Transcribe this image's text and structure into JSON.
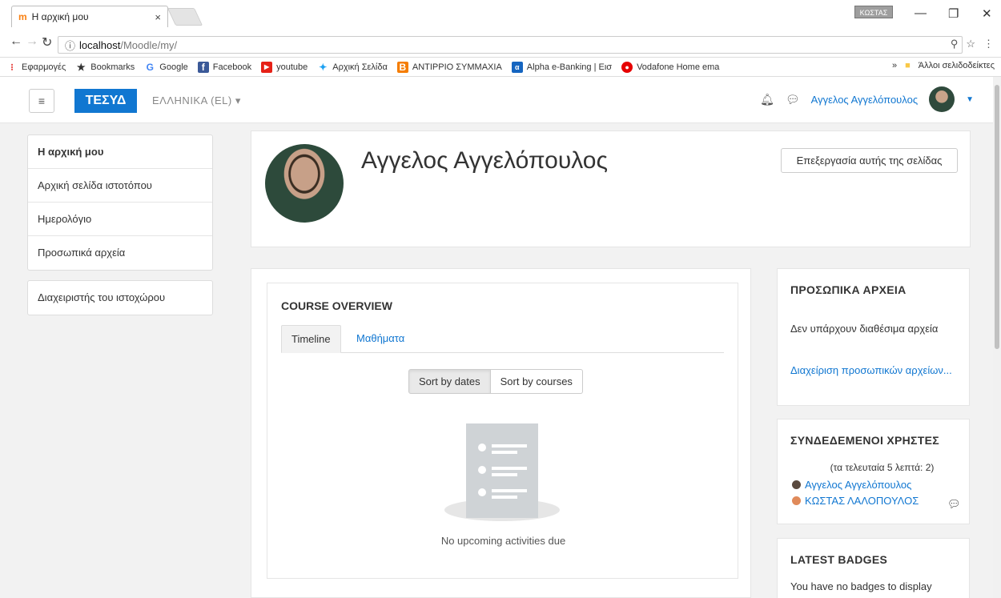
{
  "browser": {
    "tab_title": "Η αρχική μου",
    "tab_close": "×",
    "favicon": "m",
    "profile_badge": "ΚΩΣΤΑΣ",
    "url_host": "localhost",
    "url_path": "/Moodle/my/",
    "bookmarks": [
      {
        "label": "Εφαρμογές",
        "icon": "apps-icon",
        "color": "#e53935"
      },
      {
        "label": "Bookmarks",
        "icon": "star-icon",
        "color": "#333333"
      },
      {
        "label": "Google",
        "icon": "google-icon",
        "color": "#4285f4"
      },
      {
        "label": "Facebook",
        "icon": "facebook-icon",
        "color": "#3b5998"
      },
      {
        "label": "youtube",
        "icon": "youtube-icon",
        "color": "#e62117"
      },
      {
        "label": "Αρχική Σελίδα",
        "icon": "twitter-icon",
        "color": "#1da1f2"
      },
      {
        "label": "ΑΝΤΙΡΡΙΟ ΣΥΜΜΑΧΙΑ",
        "icon": "blogger-icon",
        "color": "#f57d00"
      },
      {
        "label": "Alpha e-Banking | Εισ",
        "icon": "bank-icon",
        "color": "#1565c0"
      },
      {
        "label": "Vodafone Home ema",
        "icon": "vodafone-icon",
        "color": "#e60000"
      }
    ],
    "bookmarks_more": "»",
    "other_bookmarks": "Άλλοι σελιδοδείκτες"
  },
  "navbar": {
    "menu_icon": "≡",
    "brand": "ΤΕΣΥΔ",
    "language": "ΕΛΛΗΝΙΚΑ (EL) ▾",
    "user_name": "Αγγελος Αγγελόπουλος",
    "accent": "#1177d1"
  },
  "sidebar": {
    "items": [
      {
        "label": "Η αρχική μου",
        "active": true
      },
      {
        "label": "Αρχική σελίδα ιστοτόπου"
      },
      {
        "label": "Ημερολόγιο"
      },
      {
        "label": "Προσωπικά αρχεία"
      }
    ],
    "admin_item": "Διαχειριστής του ιστοχώρου"
  },
  "header": {
    "title": "Αγγελος Αγγελόπουλος",
    "edit_button": "Επεξεργασία αυτής της σελίδας"
  },
  "overview": {
    "title": "COURSE OVERVIEW",
    "tabs": [
      "Timeline",
      "Μαθήματα"
    ],
    "sort_dates": "Sort by dates",
    "sort_courses": "Sort by courses",
    "empty_text": "No upcoming activities due"
  },
  "blocks": {
    "files": {
      "title": "ΠΡΟΣΩΠΙΚΑ ΑΡΧΕΙΑ",
      "empty": "Δεν υπάρχουν διαθέσιμα αρχεία",
      "manage_link": "Διαχείριση προσωπικών αρχείων..."
    },
    "online": {
      "title": "ΣΥΝΔΕΔΕΜΕΝΟΙ ΧΡΗΣΤΕΣ",
      "count": "(τα τελευταία 5 λεπτά: 2)",
      "users": [
        "Αγγελος Αγγελόπουλος",
        "ΚΩΣΤΑΣ ΛΑΛΟΠΟΥΛΟΣ"
      ]
    },
    "badges": {
      "title": "LATEST BADGES",
      "empty": "You have no badges to display"
    }
  }
}
